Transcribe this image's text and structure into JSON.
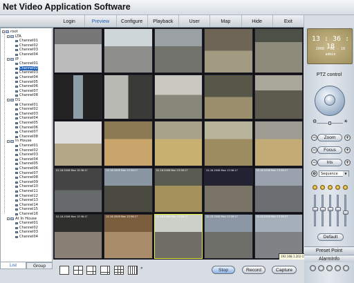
{
  "app": {
    "title": "Net Video Application Software"
  },
  "menu": [
    {
      "label": "Login",
      "active": false
    },
    {
      "label": "Preview",
      "active": true
    },
    {
      "label": "Configure",
      "active": false
    },
    {
      "label": "Playback",
      "active": false
    },
    {
      "label": "User",
      "active": false
    },
    {
      "label": "Map",
      "active": false
    },
    {
      "label": "Hide",
      "active": false
    },
    {
      "label": "Exit",
      "active": false
    }
  ],
  "tree": {
    "root": "root",
    "groups": [
      {
        "name": "LTA",
        "channels": [
          "Channel01",
          "Channel02",
          "Channel03",
          "Channel04"
        ]
      },
      {
        "name": "IP",
        "channels": [
          "Channel01",
          "Channel02",
          "Channel03",
          "Channel04",
          "Channel05",
          "Channel06",
          "Channel07",
          "Channel08"
        ],
        "selected": 1
      },
      {
        "name": "D1",
        "channels": [
          "Channel01",
          "Channel02",
          "Channel03",
          "Channel04",
          "Channel05",
          "Channel06",
          "Channel07",
          "Channel08"
        ]
      },
      {
        "name": "In House",
        "channels": [
          "Channel01",
          "Channel02",
          "Channel03",
          "Channel04",
          "Channel05",
          "Channel06",
          "Channel07",
          "Channel08",
          "Channel09",
          "Channel10",
          "Channel11",
          "Channel12",
          "Channel13",
          "Channel14",
          "Channel15",
          "Channel16"
        ]
      },
      {
        "name": "At In House",
        "channels": [
          "Channel01",
          "Channel02",
          "Channel03",
          "Channel04"
        ]
      }
    ],
    "tabs": [
      {
        "label": "List",
        "active": true
      },
      {
        "label": "Group",
        "active": false
      }
    ]
  },
  "clock": {
    "time": "13 : 36 : 18",
    "date": "2008 - 02 - 18",
    "user": "admin"
  },
  "ptz": {
    "title": "PTZ control",
    "zoom": "Zoom",
    "focus": "Focus",
    "iris": "Iris",
    "sequence": "Sequence",
    "default": "Default"
  },
  "preset_label": "Preset Point",
  "alarm_label": "AlarmInfo",
  "tooltip": "192.168.1.202 Channel04",
  "bottom": {
    "stop": "Stop",
    "record": "Record",
    "capture": "Capture"
  },
  "timestamp_text": "02-18-2008 Mon 13:36:17",
  "colors": {
    "accent": "#1e5fb8",
    "focus_border": "#e9ef3a",
    "clock_bg": "#b5a574"
  }
}
